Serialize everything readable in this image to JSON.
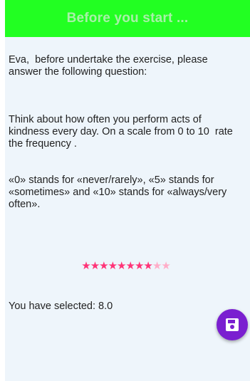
{
  "header": {
    "title": "Before you start ..."
  },
  "question": {
    "intro": "Eva,  before undertake the exercise, please answer the following question:",
    "body_lines": [
      "Think about how often you perform acts of kindness every day. On a scale from 0 to 10  rate the frequency .",
      "«0» stands for «never/rarely», «5» stands for «sometimes» and «10» stands for «always/very often»."
    ]
  },
  "rating": {
    "value": 8,
    "max": 10,
    "filled_color": "#ff3377",
    "empty_color": "#ffadc8",
    "star_glyph": "★"
  },
  "selection": {
    "text": "You have selected: 8.0"
  },
  "fab": {
    "icon": "save-icon",
    "color": "#7a1fd0"
  },
  "colors": {
    "header_bg": "#22ff22",
    "header_text": "#a8f0a8",
    "screen_bg": "#eef5fb"
  }
}
